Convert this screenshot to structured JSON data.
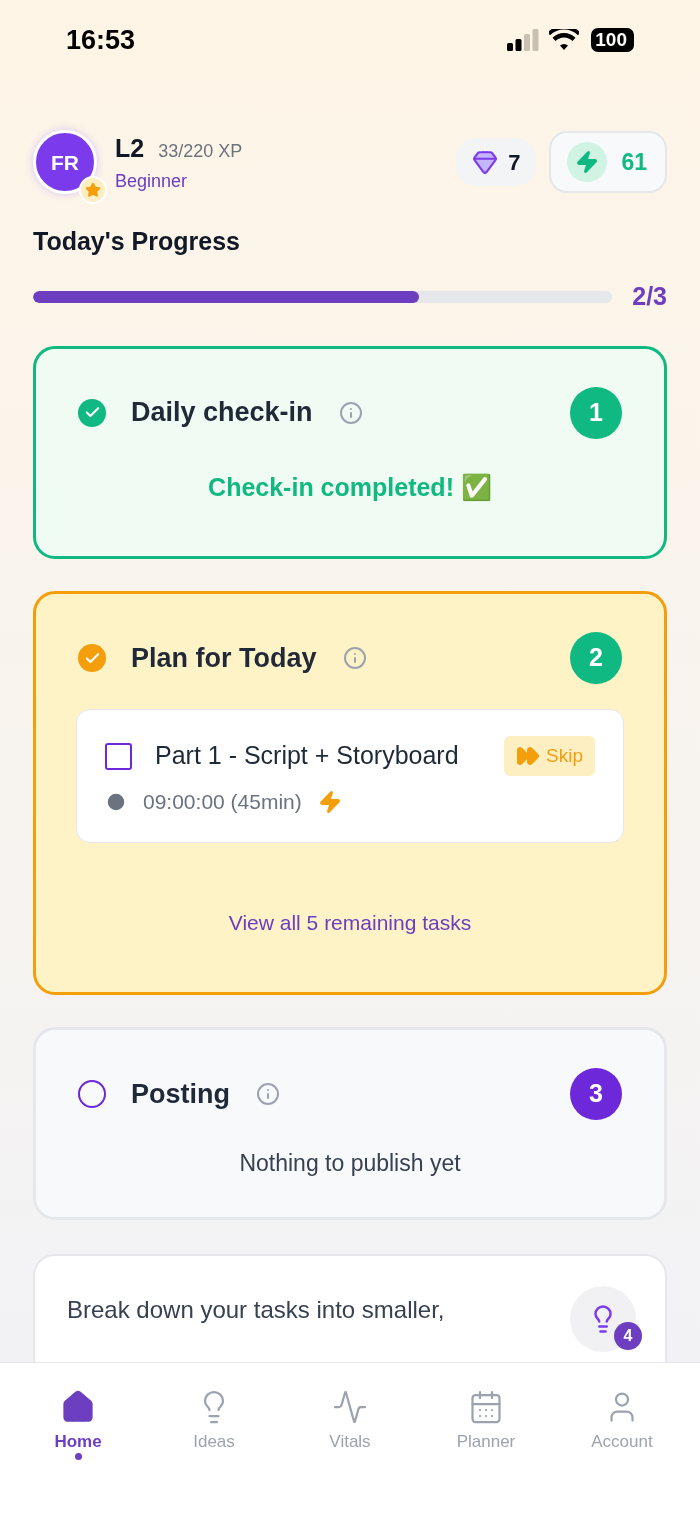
{
  "status_bar": {
    "time": "16:53",
    "battery": "100"
  },
  "profile": {
    "initials": "FR",
    "level": "L2",
    "xp": "33/220 XP",
    "rank": "Beginner"
  },
  "gems": {
    "count": "7"
  },
  "energy": {
    "count": "61"
  },
  "progress": {
    "title": "Today's Progress",
    "level": 0.667,
    "reading": "2/3"
  },
  "steps": [
    {
      "kind": "checkin",
      "checked": true,
      "title": "Daily check-in",
      "number": "1",
      "color": "#10b981",
      "message": "Check-in completed! ✅"
    },
    {
      "kind": "plan",
      "checked": true,
      "title": "Plan for Today",
      "number": "2",
      "color": "#10b981",
      "task": {
        "title": "Part 1 - Script + Storyboard",
        "checked": false,
        "time": "09:00:00 (45min)",
        "skip": "Skip"
      },
      "link": "View all 5 remaining tasks"
    },
    {
      "kind": "posting",
      "checked": false,
      "title": "Posting",
      "number": "3",
      "color": "#6d28d9",
      "message": "Nothing to publish yet"
    }
  ],
  "tip": {
    "text": "Break down your tasks into smaller,",
    "badge": "4"
  },
  "nav": [
    {
      "label": "Home",
      "selected": true
    },
    {
      "label": "Ideas",
      "selected": false
    },
    {
      "label": "Vitals",
      "selected": false
    },
    {
      "label": "Planner",
      "selected": false
    },
    {
      "label": "Account",
      "selected": false
    }
  ]
}
